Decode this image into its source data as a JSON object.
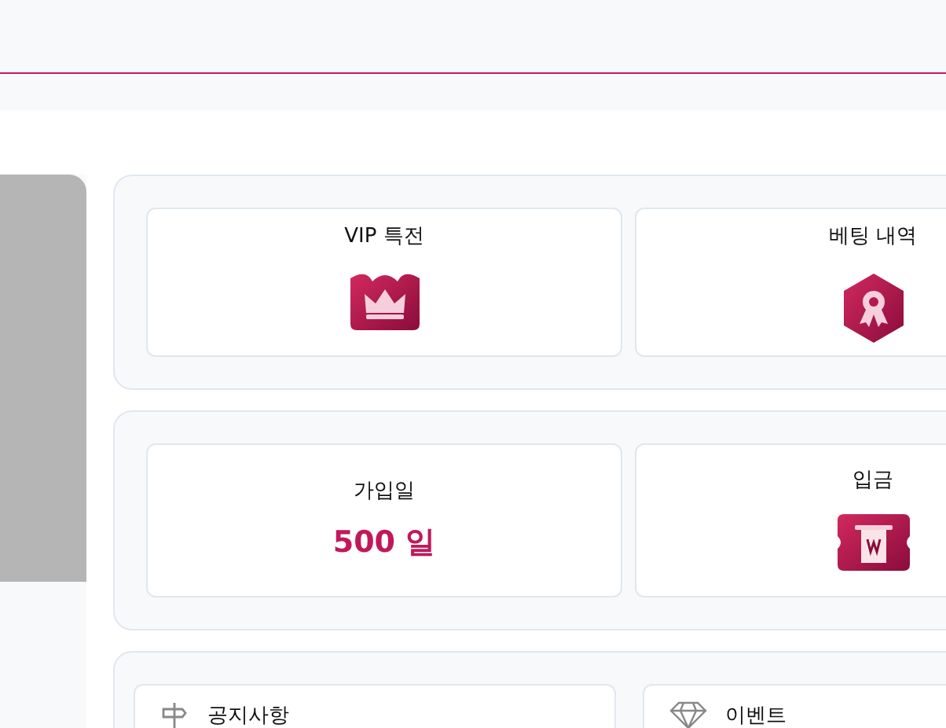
{
  "summary_cards": [
    {
      "kind": "icon",
      "title": "VIP 특전"
    },
    {
      "kind": "icon",
      "title": "베팅 내역"
    }
  ],
  "account_cards": [
    {
      "kind": "stat",
      "title": "가입일",
      "value": "500 일"
    },
    {
      "kind": "icon",
      "title": "입금"
    }
  ],
  "menu_links": [
    {
      "label": "공지사항"
    },
    {
      "label": "이벤트"
    }
  ]
}
